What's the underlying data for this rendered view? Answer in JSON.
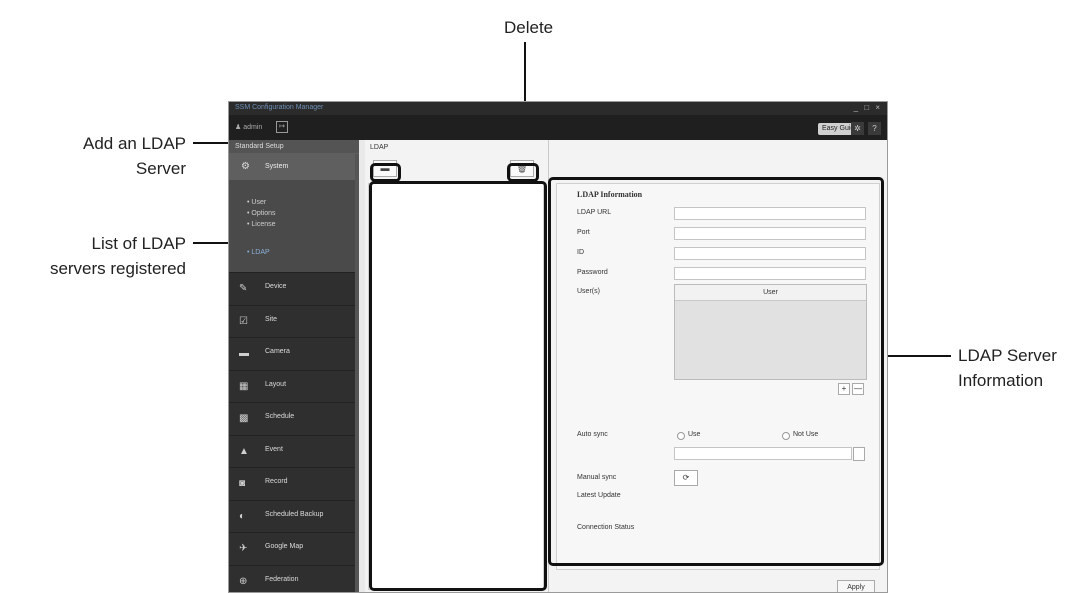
{
  "callouts": {
    "delete": "Delete",
    "add_line1": "Add an LDAP",
    "add_line2": "Server",
    "list_line1": "List of LDAP",
    "list_line2": "servers registered",
    "info_line1": "LDAP Server",
    "info_line2": "Information"
  },
  "window": {
    "title": "SSM Configuration Manager",
    "controls": "_ □ ×",
    "user": "admin",
    "easy_guide": "Easy Guide",
    "settings_icon": "gear-icon",
    "help": "?"
  },
  "sidebar": {
    "header": "Standard Setup",
    "system": "System",
    "system_sub": [
      "• User",
      "• Options",
      "• License",
      "• LDAP"
    ],
    "items": [
      {
        "label": "Device",
        "icon": "device-icon",
        "glyph": "✎"
      },
      {
        "label": "Site",
        "icon": "site-icon",
        "glyph": "☑"
      },
      {
        "label": "Camera",
        "icon": "camera-icon",
        "glyph": "▬"
      },
      {
        "label": "Layout",
        "icon": "layout-icon",
        "glyph": "▦"
      },
      {
        "label": "Schedule",
        "icon": "schedule-icon",
        "glyph": "▩"
      },
      {
        "label": "Event",
        "icon": "event-icon",
        "glyph": "▲"
      },
      {
        "label": "Record",
        "icon": "record-icon",
        "glyph": "◙"
      },
      {
        "label": "Scheduled Backup",
        "icon": "backup-icon",
        "glyph": "◐"
      },
      {
        "label": "Google Map",
        "icon": "map-icon",
        "glyph": "✈"
      },
      {
        "label": "Federation",
        "icon": "federation-icon",
        "glyph": "⊕"
      }
    ]
  },
  "list_panel": {
    "tab": "LDAP"
  },
  "info": {
    "section_title": "LDAP Information",
    "ldap_url": "LDAP URL",
    "port": "Port",
    "id": "ID",
    "password": "Password",
    "users": "User(s)",
    "user_col": "User",
    "add": "+",
    "remove": "—",
    "auto_sync": "Auto sync",
    "use": "Use",
    "not_use": "Not Use",
    "manual_sync": "Manual sync",
    "latest_update": "Latest Update",
    "connection_status": "Connection Status",
    "apply": "Apply"
  }
}
